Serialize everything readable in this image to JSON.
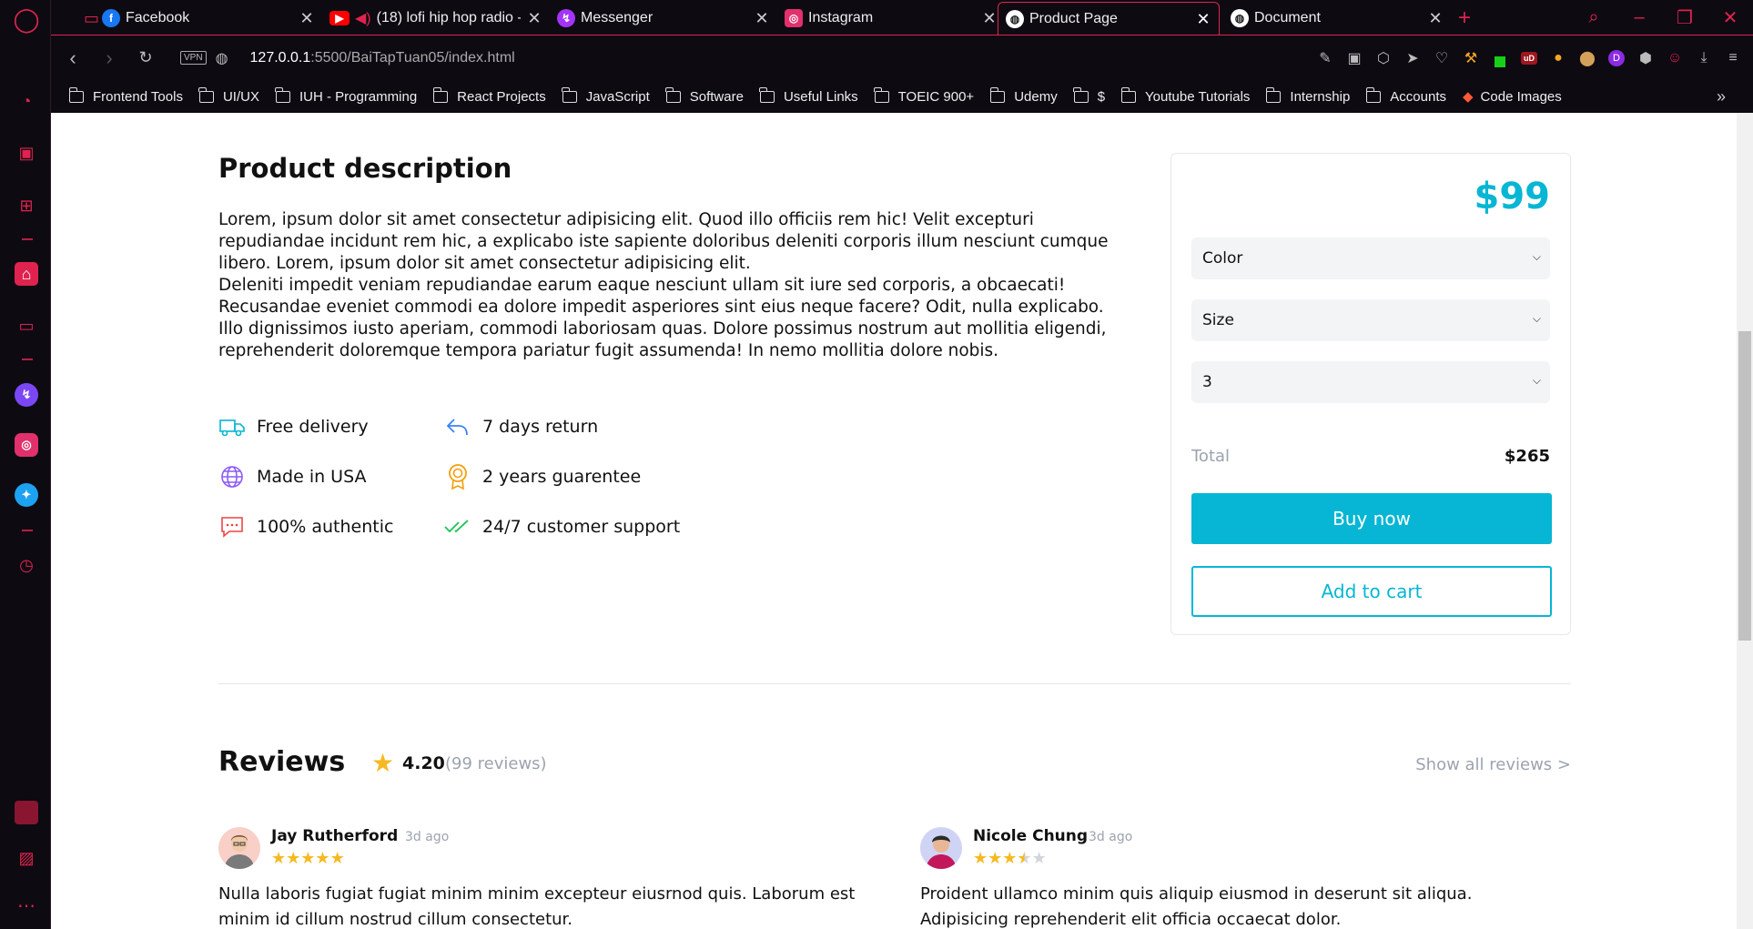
{
  "browser": {
    "tabs": [
      {
        "label": "Facebook",
        "icon": "facebook-icon",
        "color": "#1877f2"
      },
      {
        "label": "(18) lofi hip hop radio -",
        "icon": "youtube-icon",
        "color": "#ff0000"
      },
      {
        "label": "Messenger",
        "icon": "messenger-icon",
        "color": "#a334fa"
      },
      {
        "label": "Instagram",
        "icon": "instagram-icon",
        "color": "#e1306c"
      },
      {
        "label": "Product Page",
        "icon": "globe-icon",
        "color": "#ffffff"
      },
      {
        "label": "Document",
        "icon": "globe-icon",
        "color": "#ffffff"
      }
    ],
    "new_tab": "+",
    "vpn_label": "VPN",
    "url_host": "127.0.0.1",
    "url_rest": ":5500/BaiTapTuan05/index.html",
    "bookmarks": [
      "Frontend Tools",
      "UI/UX",
      "IUH - Programming",
      "React Projects",
      "JavaScript",
      "Software",
      "Useful Links",
      "TOEIC 900+",
      "Udemy",
      "$",
      "Youtube Tutorials",
      "Internship",
      "Accounts",
      "Code Images"
    ],
    "accent": "#e0234e"
  },
  "product": {
    "description_title": "Product description",
    "description_paragraphs": [
      "Lorem, ipsum dolor sit amet consectetur adipisicing elit. Quod illo officiis rem hic! Velit excepturi repudiandae incidunt rem hic, a explicabo iste sapiente doloribus deleniti corporis illum nesciunt cumque libero. Lorem, ipsum dolor sit amet consectetur adipisicing elit.",
      "Deleniti impedit veniam repudiandae earum eaque nesciunt ullam sit iure sed corporis, a obcaecati! Recusandae eveniet commodi ea dolore impedit asperiores sint eius neque facere? Odit, nulla explicabo. Illo dignissimos iusto aperiam, commodi laboriosam quas. Dolore possimus nostrum aut mollitia eligendi, reprehenderit doloremque tempora pariatur fugit assumenda! In nemo mollitia dolore nobis."
    ],
    "features": [
      {
        "label": "Free delivery",
        "icon": "truck-icon"
      },
      {
        "label": "7 days return",
        "icon": "return-arrow-icon"
      },
      {
        "label": "Made in USA",
        "icon": "globe-icon"
      },
      {
        "label": "2 years guarentee",
        "icon": "award-icon"
      },
      {
        "label": "100% authentic",
        "icon": "chat-icon"
      },
      {
        "label": "24/7 customer support",
        "icon": "double-check-icon"
      }
    ],
    "price": "$99",
    "selects": {
      "color": "Color",
      "size": "Size",
      "quantity": "3"
    },
    "total_label": "Total",
    "total_value": "$265",
    "buy_now": "Buy now",
    "add_to_cart": "Add to cart",
    "brand_color": "#06b6d4"
  },
  "reviews": {
    "title": "Reviews",
    "rating": "4.20",
    "count": "(99 reviews)",
    "show_all": "Show all reviews >",
    "items": [
      {
        "name": "Jay Rutherford",
        "time": "3d ago",
        "stars": 5,
        "text": "Nulla laboris fugiat fugiat minim minim excepteur eiusrnod quis. Laborum est minim id cillum nostrud cillum consectetur."
      },
      {
        "name": "Nicole Chung",
        "time": "3d ago",
        "stars": 3.5,
        "text": "Proident ullamco minim quis aliquip eiusmod in deserunt sit aliqua. Adipisicing reprehenderit elit officia occaecat dolor."
      }
    ]
  }
}
